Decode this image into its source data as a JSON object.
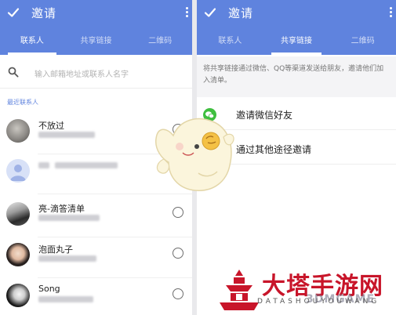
{
  "left_screen": {
    "title": "邀请",
    "tabs": [
      {
        "label": "联系人",
        "active": true
      },
      {
        "label": "共享链接",
        "active": false
      },
      {
        "label": "二维码",
        "active": false
      }
    ],
    "search": {
      "placeholder": "输入邮箱地址或联系人名字",
      "icon": "search-icon"
    },
    "section_label": "最近联系人",
    "contacts": [
      {
        "name": "不放过",
        "selected": false
      },
      {
        "name": "",
        "selected": false
      },
      {
        "name": "亮-滴答清单",
        "selected": false
      },
      {
        "name": "泡面丸子",
        "selected": false
      },
      {
        "name": "Song",
        "selected": false
      }
    ]
  },
  "right_screen": {
    "title": "邀请",
    "tabs": [
      {
        "label": "联系人",
        "active": false
      },
      {
        "label": "共享链接",
        "active": true
      },
      {
        "label": "二维码",
        "active": false
      }
    ],
    "description": "将共享链接通过微信、QQ等渠道发送给朋友，邀请他们加入清单。",
    "options": [
      {
        "label": "邀请微信好友",
        "icon": "wechat-icon"
      },
      {
        "label": "通过其他途径邀请",
        "icon": ""
      }
    ]
  },
  "watermark": {
    "title": "大塔手游网",
    "subtitle": "DATASHOUYOUWANG",
    "brand": "3DMGAME"
  },
  "colors": {
    "app_bar": "#5f83de",
    "accent_text": "#5f83de",
    "watermark_red": "#c8152a",
    "wechat_green": "#3fbf3f"
  }
}
